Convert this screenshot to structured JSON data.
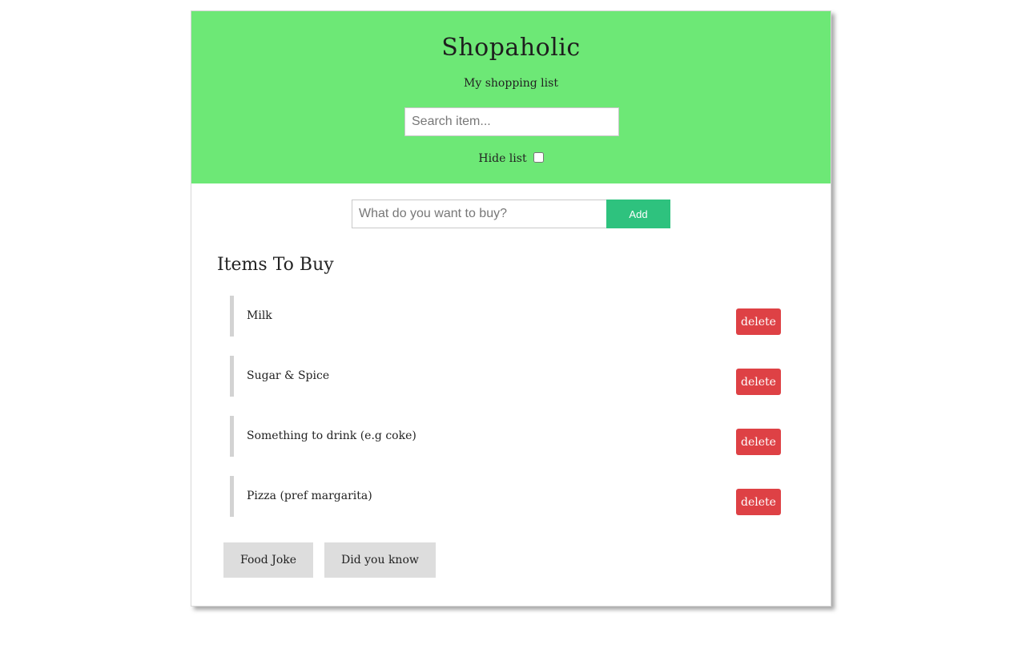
{
  "header": {
    "title": "Shopaholic",
    "subtitle": "My shopping list",
    "search_placeholder": "Search item...",
    "hide_label": "Hide list",
    "hide_checked": false,
    "background_color": "#6de876"
  },
  "add_form": {
    "placeholder": "What do you want to buy?",
    "button_label": "Add",
    "button_color": "#2ec27e"
  },
  "list": {
    "heading": "Items To Buy",
    "items": [
      {
        "name": "Milk",
        "delete_label": "delete"
      },
      {
        "name": "Sugar & Spice",
        "delete_label": "delete"
      },
      {
        "name": "Something to drink (e.g coke)",
        "delete_label": "delete"
      },
      {
        "name": "Pizza (pref margarita)",
        "delete_label": "delete"
      }
    ],
    "delete_color": "#de4145"
  },
  "footer": {
    "food_joke_label": "Food Joke",
    "did_you_know_label": "Did you know"
  }
}
